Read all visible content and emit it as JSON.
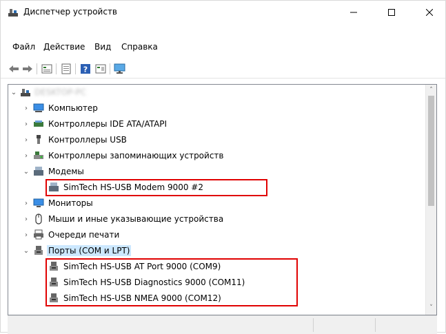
{
  "window": {
    "title": "Диспетчер устройств",
    "minimize_icon": "minimize-icon",
    "maximize_icon": "maximize-icon",
    "close_icon": "close-icon"
  },
  "menu": [
    "Файл",
    "Действие",
    "Вид",
    "Справка"
  ],
  "toolbar": {
    "icons": [
      "back-arrow-icon",
      "forward-arrow-icon",
      "properties-icon",
      "update-driver-icon",
      "help-icon",
      "view-icon",
      "monitor-scan-icon"
    ]
  },
  "tree": {
    "root_label": "DESKTOP-PC",
    "items": [
      {
        "label": "Компьютер",
        "icon": "computer-icon",
        "expanded": false
      },
      {
        "label": "Контроллеры IDE ATA/ATAPI",
        "icon": "ide-controller-icon",
        "expanded": false
      },
      {
        "label": "Контроллеры USB",
        "icon": "usb-icon",
        "expanded": false
      },
      {
        "label": "Контроллеры запоминающих устройств",
        "icon": "storage-controller-icon",
        "expanded": false
      },
      {
        "label": "Модемы",
        "icon": "modem-icon",
        "expanded": true,
        "children": [
          {
            "label": "SimTech HS-USB Modem 9000 #2",
            "icon": "modem-device-icon"
          }
        ]
      },
      {
        "label": "Мониторы",
        "icon": "monitor-icon",
        "expanded": false
      },
      {
        "label": "Мыши и иные указывающие устройства",
        "icon": "mouse-icon",
        "expanded": false
      },
      {
        "label": "Очереди печати",
        "icon": "printer-icon",
        "expanded": false
      },
      {
        "label": "Порты (COM и LPT)",
        "icon": "port-icon",
        "expanded": true,
        "selected": true,
        "children": [
          {
            "label": "SimTech HS-USB AT Port 9000 (COM9)",
            "icon": "port-device-icon"
          },
          {
            "label": "SimTech HS-USB Diagnostics 9000 (COM11)",
            "icon": "port-device-icon"
          },
          {
            "label": "SimTech HS-USB NMEA 9000 (COM12)",
            "icon": "port-device-icon"
          }
        ]
      }
    ]
  },
  "colors": {
    "highlight_box": "#e00000",
    "selection": "#cce8ff"
  }
}
